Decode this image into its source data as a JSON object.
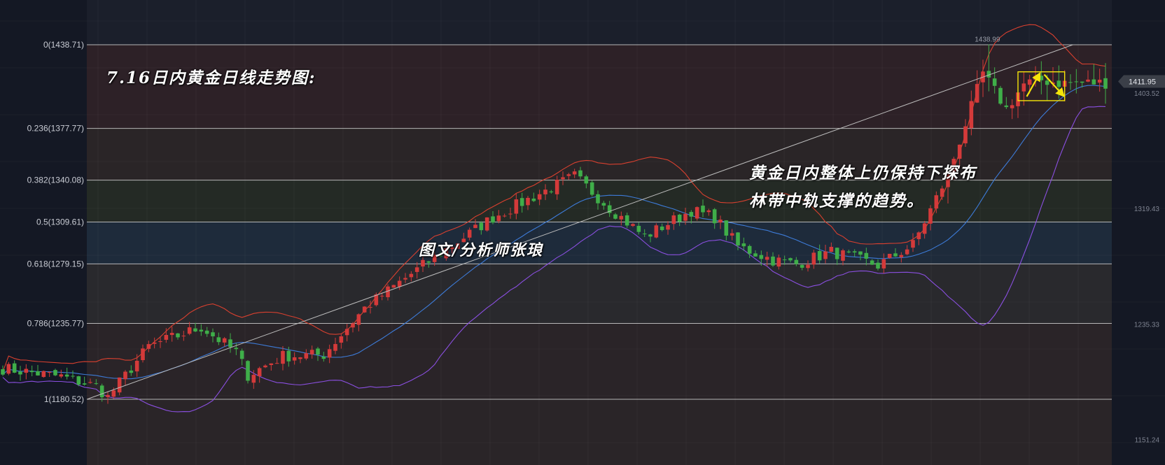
{
  "annotations": {
    "title": "7.16日内黄金日线走势图:",
    "author": "图文/分析师张琅",
    "trend_line1": "黄金日内整体上仍保持下探布",
    "trend_line2": "林带中轨支撑的趋势。"
  },
  "colors": {
    "background": "#141824",
    "up_candle": "#d43a3a",
    "down_candle": "#3fae49",
    "bollinger_upper": "#d9402f",
    "bollinger_middle": "#3d7bd8",
    "bollinger_lower": "#8a4fe0",
    "trendline": "#bdbdbd",
    "fib_line": "#d0d0d0",
    "highlight_box": "#f5e50a"
  },
  "chart_data": {
    "type": "candlestick",
    "instrument": "XAUUSD daily",
    "ylim": [
      1135,
      1448
    ],
    "fibonacci_levels": [
      {
        "ratio": 0,
        "price": 1438.71,
        "label": "0(1438.71)"
      },
      {
        "ratio": 0.236,
        "price": 1377.77,
        "label": "0.236(1377.77)"
      },
      {
        "ratio": 0.382,
        "price": 1340.08,
        "label": "0.382(1340.08)"
      },
      {
        "ratio": 0.5,
        "price": 1309.61,
        "label": "0.5(1309.61)"
      },
      {
        "ratio": 0.618,
        "price": 1279.15,
        "label": "0.618(1279.15)"
      },
      {
        "ratio": 0.786,
        "price": 1235.77,
        "label": "0.786(1235.77)"
      },
      {
        "ratio": 1,
        "price": 1180.52,
        "label": "1(1180.52)"
      }
    ],
    "right_axis_labels": [
      {
        "price": 1403.52,
        "label": "1403.52"
      },
      {
        "price": 1319.43,
        "label": "1319.43"
      },
      {
        "price": 1235.33,
        "label": "1235.33"
      },
      {
        "price": 1151.24,
        "label": "1151.24"
      }
    ],
    "current_price": {
      "price": 1411.95,
      "label": "1411.95"
    },
    "session_high": {
      "price": 1438.99,
      "label": "1438.99"
    },
    "trendline": {
      "start": {
        "bar": 0,
        "price": 1180.5
      },
      "end": {
        "bar": 181,
        "price": 1438.7
      }
    },
    "highlight_box": {
      "bar_from": 174,
      "bar_to": 182,
      "price_top": 1419,
      "price_bottom": 1398
    },
    "arrows": [
      {
        "from": {
          "bar": 175.5,
          "price": 1401
        },
        "to": {
          "bar": 177.5,
          "price": 1416
        }
      },
      {
        "from": {
          "bar": 178.5,
          "price": 1417
        },
        "to": {
          "bar": 181.5,
          "price": 1403
        }
      }
    ],
    "anchors": {
      "first_bar_price": 1203,
      "bar_count": 190,
      "waypoints": [
        [
          0,
          1203
        ],
        [
          10,
          1197
        ],
        [
          16,
          1190
        ],
        [
          18,
          1182
        ],
        [
          25,
          1219
        ],
        [
          34,
          1233
        ],
        [
          40,
          1215
        ],
        [
          42,
          1198
        ],
        [
          48,
          1212
        ],
        [
          55,
          1213
        ],
        [
          62,
          1247
        ],
        [
          72,
          1278
        ],
        [
          84,
          1313
        ],
        [
          90,
          1326
        ],
        [
          98,
          1343
        ],
        [
          104,
          1320
        ],
        [
          110,
          1299
        ],
        [
          118,
          1318
        ],
        [
          122,
          1313
        ],
        [
          126,
          1292
        ],
        [
          132,
          1282
        ],
        [
          136,
          1279
        ],
        [
          142,
          1288
        ],
        [
          150,
          1278
        ],
        [
          156,
          1293
        ],
        [
          162,
          1344
        ],
        [
          168,
          1418
        ],
        [
          172,
          1392
        ],
        [
          175,
          1410
        ],
        [
          178,
          1413
        ],
        [
          181,
          1411
        ]
      ]
    }
  }
}
